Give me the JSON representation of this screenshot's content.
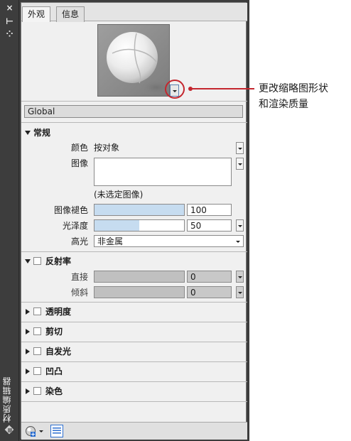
{
  "strip": {
    "title": "材质编辑器",
    "close_glyph": "×",
    "pin_glyph": "⊢",
    "settings_glyph": "⁘"
  },
  "tabs": [
    {
      "label": "外观",
      "active": true
    },
    {
      "label": "信息",
      "active": false
    }
  ],
  "material_name": "Global",
  "sections": {
    "general": {
      "label": "常规",
      "color_label": "颜色",
      "color_value": "按对象",
      "image_label": "图像",
      "image_status": "(未选定图像)",
      "image_fade_label": "图像褪色",
      "image_fade_value": "100",
      "image_fade_fill": 1.0,
      "glossiness_label": "光泽度",
      "glossiness_value": "50",
      "glossiness_fill": 0.5,
      "highlight_label": "高光",
      "highlight_value": "非金属"
    },
    "reflectivity": {
      "label": "反射率",
      "direct_label": "直接",
      "direct_value": "0",
      "oblique_label": "倾斜",
      "oblique_value": "0"
    },
    "collapsed": [
      {
        "label": "透明度"
      },
      {
        "label": "剪切"
      },
      {
        "label": "自发光"
      },
      {
        "label": "凹凸"
      },
      {
        "label": "染色"
      }
    ]
  },
  "annotation": {
    "line1": "更改缩略图形状",
    "line2": "和渲染质量"
  },
  "colors": {
    "accent": "#c4262e",
    "slider_fill": "#c6dcf0",
    "panel_dark": "#3d3d3d"
  }
}
